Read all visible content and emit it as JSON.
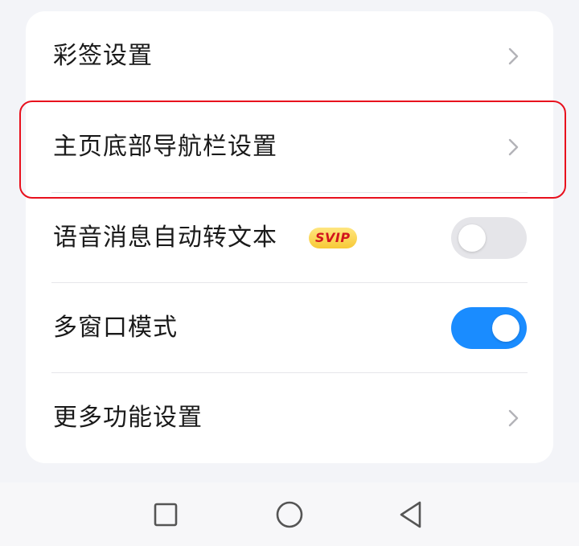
{
  "settings": {
    "items": [
      {
        "label": "彩签设置",
        "control": "chevron"
      },
      {
        "label": "主页底部导航栏设置",
        "control": "chevron",
        "highlighted": true
      },
      {
        "label": "语音消息自动转文本",
        "control": "toggle",
        "state": "off",
        "badge": "SVIP"
      },
      {
        "label": "多窗口模式",
        "control": "toggle",
        "state": "on"
      },
      {
        "label": "更多功能设置",
        "control": "chevron"
      }
    ]
  },
  "icons": {
    "chevron": "chevron-right-icon",
    "nav_recent": "square-icon",
    "nav_home": "circle-icon",
    "nav_back": "triangle-back-icon"
  },
  "colors": {
    "toggle_on": "#1a8cff",
    "toggle_off": "#e5e5e9",
    "highlight_border": "#e8101d",
    "badge_text": "#d2141e",
    "badge_bg": "#f7c936"
  }
}
